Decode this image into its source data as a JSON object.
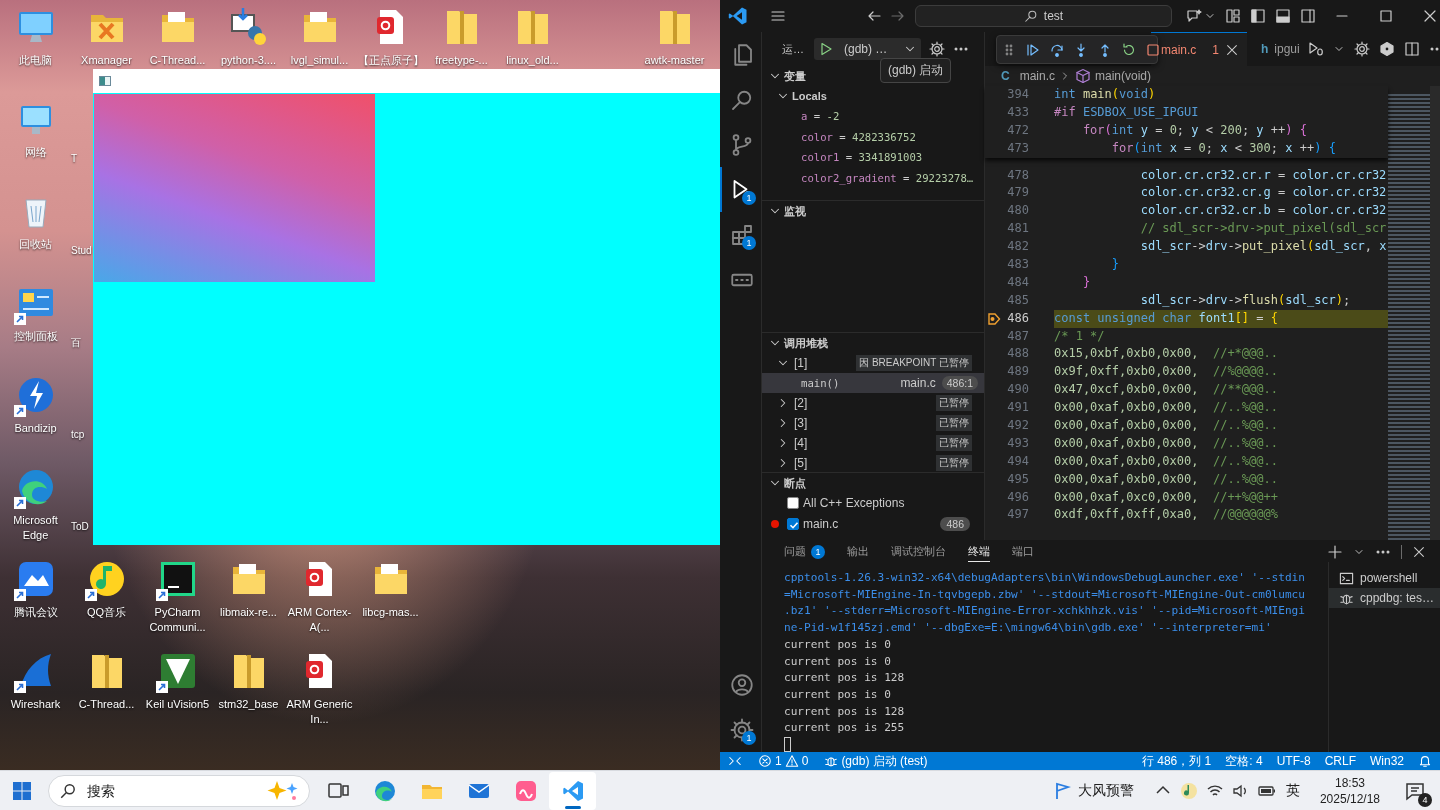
{
  "desktop": {
    "icons": [
      {
        "label": "此电脑",
        "kind": "computer",
        "shortcut": false
      },
      {
        "label": "Xmanager",
        "kind": "xmanager",
        "shortcut": false
      },
      {
        "label": "C-Thread...",
        "kind": "folder",
        "shortcut": false
      },
      {
        "label": "python-3....",
        "kind": "python",
        "shortcut": false
      },
      {
        "label": "lvgl_simul...",
        "kind": "folder",
        "shortcut": false
      },
      {
        "label": "【正点原子】",
        "kind": "pdf",
        "shortcut": false
      },
      {
        "label": "freetype-...",
        "kind": "zip",
        "shortcut": false
      },
      {
        "label": "linux_old...",
        "kind": "zip",
        "shortcut": false
      },
      {
        "label": "awtk-master",
        "kind": "zip",
        "shortcut": false
      },
      {
        "label": "网络",
        "kind": "network",
        "shortcut": false
      },
      {
        "label": "T",
        "kind": "clipped",
        "shortcut": false
      },
      {
        "label": "回收站",
        "kind": "recycle",
        "shortcut": false
      },
      {
        "label": "Stud",
        "kind": "clipped",
        "shortcut": false
      },
      {
        "label": "控制面板",
        "kind": "control",
        "shortcut": true
      },
      {
        "label": "百",
        "kind": "clipped",
        "shortcut": false
      },
      {
        "label": "Bandizip",
        "kind": "bandizip",
        "shortcut": true
      },
      {
        "label": "tcp",
        "kind": "clipped",
        "shortcut": false
      },
      {
        "label": "Microsoft Edge",
        "kind": "edge",
        "shortcut": true
      },
      {
        "label": "ToD",
        "kind": "clipped",
        "shortcut": false
      },
      {
        "label": "腾讯会议",
        "kind": "meeting",
        "shortcut": true
      },
      {
        "label": "QQ音乐",
        "kind": "music",
        "shortcut": true
      },
      {
        "label": "PyCharm Communi...",
        "kind": "pycharm",
        "shortcut": true
      },
      {
        "label": "libmaix-re...",
        "kind": "folder",
        "shortcut": false
      },
      {
        "label": "ARM Cortex-A(...",
        "kind": "pdf",
        "shortcut": false
      },
      {
        "label": "libcg-mas...",
        "kind": "folder",
        "shortcut": false
      },
      {
        "label": "Wireshark",
        "kind": "wireshark",
        "shortcut": true
      },
      {
        "label": "C-Thread...",
        "kind": "zip",
        "shortcut": false
      },
      {
        "label": "Keil uVision5",
        "kind": "keil",
        "shortcut": true
      },
      {
        "label": "stm32_base",
        "kind": "zip",
        "shortcut": false
      },
      {
        "label": "ARM Generic In...",
        "kind": "pdf",
        "shortcut": false
      }
    ]
  },
  "vscode": {
    "title_bar": {
      "search": "test"
    },
    "activity_bar": {
      "top": [
        {
          "kind": "explorer",
          "selected": false
        },
        {
          "kind": "search",
          "selected": false
        },
        {
          "kind": "source_control",
          "selected": false
        },
        {
          "kind": "run_debug",
          "selected": true,
          "badge": "1"
        },
        {
          "kind": "extensions",
          "selected": false,
          "badge": "1"
        },
        {
          "kind": "device",
          "selected": false
        }
      ],
      "bottom": [
        {
          "kind": "account",
          "selected": false
        },
        {
          "kind": "settings",
          "selected": false,
          "badge": "1"
        }
      ]
    },
    "sidebar": {
      "title": "运…",
      "config": "(gdb) …",
      "tooltip": "(gdb) 启动",
      "variables": {
        "title": "变量",
        "expanded": true,
        "scopes": [
          {
            "label": "Locals",
            "expanded": true,
            "children": [
              {
                "name": "a",
                "operator": "=",
                "value": "-2"
              },
              {
                "name": "color",
                "operator": "=",
                "value": "4282336752"
              },
              {
                "name": "color1",
                "operator": "=",
                "value": "3341891003"
              },
              {
                "name": "color2_gradient",
                "operator": "=",
                "value": "29223278…"
              }
            ]
          }
        ]
      },
      "watch": {
        "title": "监视",
        "expanded": true
      },
      "call_stack": {
        "title": "调用堆栈",
        "expanded": true,
        "threads": [
          {
            "label": "[1]",
            "expanded": true,
            "status": "因 BREAKPOINT 已暂停",
            "children": [
              {
                "name": "main()",
                "file": "main.c",
                "position": "486:1",
                "selected": true
              }
            ]
          },
          {
            "label": "[2]",
            "expanded": false,
            "status": "已暂停"
          },
          {
            "label": "[3]",
            "expanded": false,
            "status": "已暂停"
          },
          {
            "label": "[4]",
            "expanded": false,
            "status": "已暂停"
          },
          {
            "label": "[5]",
            "expanded": false,
            "status": "已暂停"
          }
        ]
      },
      "breakpoints": {
        "title": "断点",
        "expanded": true,
        "items": [
          {
            "kind": "exception",
            "label": "All C++ Exceptions",
            "checked": false
          },
          {
            "kind": "line",
            "label": "main.c",
            "checked": true,
            "line": "486"
          }
        ]
      }
    },
    "debug_toolbar": [
      {
        "kind": "continue"
      },
      {
        "kind": "step_over"
      },
      {
        "kind": "step_into"
      },
      {
        "kind": "step_out"
      },
      {
        "kind": "restart"
      },
      {
        "kind": "stop"
      }
    ],
    "editor": {
      "tabs": [
        {
          "label": "main.c",
          "selected": true,
          "problems": "1"
        },
        {
          "label": "ipgui",
          "icon": "h",
          "selected": false
        }
      ],
      "breadcrumb": [
        {
          "kind": "file",
          "icon": "C",
          "label": "main.c"
        },
        {
          "kind": "symbol",
          "label": "main(void)"
        }
      ],
      "sticky_lines": [
        {
          "number": "394",
          "tokens": [
            {
              "kind": "type",
              "text": "int"
            },
            {
              "kind": "function",
              "text": " main"
            },
            {
              "kind": "bracket1",
              "text": "("
            },
            {
              "kind": "type",
              "text": "void"
            },
            {
              "kind": "bracket1",
              "text": ")"
            }
          ]
        },
        {
          "number": "433",
          "tokens": [
            {
              "kind": "control",
              "text": "#if"
            },
            {
              "kind": "type",
              "text": " ESDBOX_USE_IPGUI"
            }
          ]
        },
        {
          "number": "472",
          "tokens": [
            {
              "kind": "control",
              "text": "    for"
            },
            {
              "kind": "bracket2",
              "text": "("
            },
            {
              "kind": "type",
              "text": "int"
            },
            {
              "kind": "variable",
              "text": " y"
            },
            {
              "kind": "plain",
              "text": " ="
            },
            {
              "kind": "number",
              "text": " 0"
            },
            {
              "kind": "plain",
              "text": ";"
            },
            {
              "kind": "variable",
              "text": " y"
            },
            {
              "kind": "plain",
              "text": " <"
            },
            {
              "kind": "number",
              "text": " 200"
            },
            {
              "kind": "plain",
              "text": ";"
            },
            {
              "kind": "variable",
              "text": " y"
            },
            {
              "kind": "plain",
              "text": " ++"
            },
            {
              "kind": "bracket2",
              "text": ")"
            },
            {
              "kind": "bracket2",
              "text": " {"
            }
          ]
        },
        {
          "number": "473",
          "tokens": [
            {
              "kind": "control",
              "text": "        for"
            },
            {
              "kind": "bracket3",
              "text": "("
            },
            {
              "kind": "type",
              "text": "int"
            },
            {
              "kind": "variable",
              "text": " x"
            },
            {
              "kind": "plain",
              "text": " ="
            },
            {
              "kind": "number",
              "text": " 0"
            },
            {
              "kind": "plain",
              "text": ";"
            },
            {
              "kind": "variable",
              "text": " x"
            },
            {
              "kind": "plain",
              "text": " <"
            },
            {
              "kind": "number",
              "text": " 300"
            },
            {
              "kind": "plain",
              "text": ";"
            },
            {
              "kind": "variable",
              "text": " x"
            },
            {
              "kind": "plain",
              "text": " ++"
            },
            {
              "kind": "bracket3",
              "text": ")"
            },
            {
              "kind": "bracket3",
              "text": " {"
            }
          ]
        }
      ],
      "lines": [
        {
          "number": "478",
          "current": false,
          "tokens": [
            {
              "kind": "variable",
              "text": "            color.cr.cr32.cr.r"
            },
            {
              "kind": "plain",
              "text": " ="
            },
            {
              "kind": "variable",
              "text": " color.cr.cr32"
            }
          ]
        },
        {
          "number": "479",
          "current": false,
          "tokens": [
            {
              "kind": "variable",
              "text": "            color.cr.cr32.cr.g"
            },
            {
              "kind": "plain",
              "text": " ="
            },
            {
              "kind": "variable",
              "text": " color.cr.cr32"
            }
          ]
        },
        {
          "number": "480",
          "current": false,
          "tokens": [
            {
              "kind": "variable",
              "text": "            color.cr.cr32.cr.b"
            },
            {
              "kind": "plain",
              "text": " ="
            },
            {
              "kind": "variable",
              "text": " color.cr.cr32"
            }
          ]
        },
        {
          "number": "481",
          "current": false,
          "tokens": [
            {
              "kind": "comment",
              "text": "            // sdl_scr->drv->put_pixel(sdl_scr"
            }
          ]
        },
        {
          "number": "482",
          "current": false,
          "tokens": [
            {
              "kind": "variable",
              "text": "            sdl_scr"
            },
            {
              "kind": "plain",
              "text": "->"
            },
            {
              "kind": "variable",
              "text": "drv"
            },
            {
              "kind": "plain",
              "text": "->"
            },
            {
              "kind": "function",
              "text": "put_pixel"
            },
            {
              "kind": "bracket1",
              "text": "("
            },
            {
              "kind": "variable",
              "text": "sdl_scr"
            },
            {
              "kind": "plain",
              "text": ","
            },
            {
              "kind": "variable",
              "text": " x"
            }
          ]
        },
        {
          "number": "483",
          "current": false,
          "tokens": [
            {
              "kind": "bracket3",
              "text": "        }"
            }
          ]
        },
        {
          "number": "484",
          "current": false,
          "tokens": [
            {
              "kind": "bracket2",
              "text": "    }"
            }
          ]
        },
        {
          "number": "485",
          "current": false,
          "tokens": [
            {
              "kind": "variable",
              "text": "            sdl_scr"
            },
            {
              "kind": "plain",
              "text": "->"
            },
            {
              "kind": "variable",
              "text": "drv"
            },
            {
              "kind": "plain",
              "text": "->"
            },
            {
              "kind": "function",
              "text": "flush"
            },
            {
              "kind": "bracket1",
              "text": "("
            },
            {
              "kind": "variable",
              "text": "sdl_scr"
            },
            {
              "kind": "bracket1",
              "text": ")"
            },
            {
              "kind": "plain",
              "text": ";"
            }
          ]
        },
        {
          "number": "486",
          "current": true,
          "tokens": [
            {
              "kind": "type",
              "text": "const unsigned char"
            },
            {
              "kind": "variable",
              "text": " font1"
            },
            {
              "kind": "bracket1",
              "text": "[]"
            },
            {
              "kind": "plain",
              "text": " ="
            },
            {
              "kind": "bracket1",
              "text": " {"
            }
          ]
        },
        {
          "number": "487",
          "current": false,
          "tokens": [
            {
              "kind": "comment",
              "text": "/* 1 */"
            }
          ]
        },
        {
          "number": "488",
          "current": false,
          "tokens": [
            {
              "kind": "number",
              "text": "0x15,0xbf,0xb0,0x00,"
            },
            {
              "kind": "comment",
              "text": "  //+*@@@.."
            }
          ]
        },
        {
          "number": "489",
          "current": false,
          "tokens": [
            {
              "kind": "number",
              "text": "0x9f,0xff,0xb0,0x00,"
            },
            {
              "kind": "comment",
              "text": "  //%@@@@.."
            }
          ]
        },
        {
          "number": "490",
          "current": false,
          "tokens": [
            {
              "kind": "number",
              "text": "0x47,0xcf,0xb0,0x00,"
            },
            {
              "kind": "comment",
              "text": "  //**@@@.."
            }
          ]
        },
        {
          "number": "491",
          "current": false,
          "tokens": [
            {
              "kind": "number",
              "text": "0x00,0xaf,0xb0,0x00,"
            },
            {
              "kind": "comment",
              "text": "  //..%@@.."
            }
          ]
        },
        {
          "number": "492",
          "current": false,
          "tokens": [
            {
              "kind": "number",
              "text": "0x00,0xaf,0xb0,0x00,"
            },
            {
              "kind": "comment",
              "text": "  //..%@@.."
            }
          ]
        },
        {
          "number": "493",
          "current": false,
          "tokens": [
            {
              "kind": "number",
              "text": "0x00,0xaf,0xb0,0x00,"
            },
            {
              "kind": "comment",
              "text": "  //..%@@.."
            }
          ]
        },
        {
          "number": "494",
          "current": false,
          "tokens": [
            {
              "kind": "number",
              "text": "0x00,0xaf,0xb0,0x00,"
            },
            {
              "kind": "comment",
              "text": "  //..%@@.."
            }
          ]
        },
        {
          "number": "495",
          "current": false,
          "tokens": [
            {
              "kind": "number",
              "text": "0x00,0xaf,0xb0,0x00,"
            },
            {
              "kind": "comment",
              "text": "  //..%@@.."
            }
          ]
        },
        {
          "number": "496",
          "current": false,
          "tokens": [
            {
              "kind": "number",
              "text": "0x00,0xaf,0xc0,0x00,"
            },
            {
              "kind": "comment",
              "text": "  //++%@@++"
            }
          ]
        },
        {
          "number": "497",
          "current": false,
          "tokens": [
            {
              "kind": "number",
              "text": "0xdf,0xff,0xff,0xa0,"
            },
            {
              "kind": "comment",
              "text": "  //@@@@@@%"
            }
          ]
        }
      ]
    },
    "panel": {
      "tabs": [
        {
          "label": "问题",
          "selected": false,
          "badge": "1"
        },
        {
          "label": "输出",
          "selected": false
        },
        {
          "label": "调试控制台",
          "selected": false
        },
        {
          "label": "终端",
          "selected": true
        },
        {
          "label": "端口",
          "selected": false
        }
      ],
      "terminal_lines": [
        {
          "kind": "command",
          "text": "cpptools-1.26.3-win32-x64\\debugAdapters\\bin\\WindowsDebugLauncher.exe' '--stdin"
        },
        {
          "kind": "command",
          "text": "=Microsoft-MIEngine-In-tqvbgepb.zbw' '--stdout=Microsoft-MIEngine-Out-cm0lumcu"
        },
        {
          "kind": "command",
          "text": ".bz1' '--stderr=Microsoft-MIEngine-Error-xchkhhzk.vis' '--pid=Microsoft-MIEngi"
        },
        {
          "kind": "command",
          "text": "ne-Pid-w1f145zj.emd' '--dbgExe=E:\\mingw64\\bin\\gdb.exe' '--interpreter=mi'"
        },
        {
          "kind": "output",
          "text": "current pos is 0"
        },
        {
          "kind": "output",
          "text": "current pos is 0"
        },
        {
          "kind": "output",
          "text": "current pos is 128"
        },
        {
          "kind": "output",
          "text": "current pos is 0"
        },
        {
          "kind": "output",
          "text": "current pos is 128"
        },
        {
          "kind": "output",
          "text": "current pos is 255"
        }
      ],
      "terminals": [
        {
          "kind": "shell",
          "label": "powershell",
          "selected": false
        },
        {
          "kind": "debug",
          "label": "cppdbg: tes…",
          "selected": true
        }
      ]
    },
    "status_bar": {
      "left": [
        {
          "kind": "remote"
        },
        {
          "kind": "problems",
          "errors": "1",
          "warnings": "0"
        },
        {
          "kind": "debug",
          "label": "(gdb) 启动 (test)"
        }
      ],
      "right": [
        {
          "kind": "text",
          "label": "行 486，列 1"
        },
        {
          "kind": "text",
          "label": "空格: 4"
        },
        {
          "kind": "text",
          "label": "UTF-8"
        },
        {
          "kind": "text",
          "label": "CRLF"
        },
        {
          "kind": "text",
          "label": "Win32"
        },
        {
          "kind": "bell"
        }
      ]
    }
  },
  "taskbar": {
    "search": {
      "placeholder": "搜索"
    },
    "apps": [
      {
        "kind": "task_view",
        "active": false
      },
      {
        "kind": "browser",
        "active": false
      },
      {
        "kind": "files",
        "active": false
      },
      {
        "kind": "mail",
        "active": false
      },
      {
        "kind": "pink_app",
        "active": false
      },
      {
        "kind": "code_editor",
        "active": true
      }
    ],
    "weather": "大风预警",
    "tray": [
      {
        "kind": "chevron"
      },
      {
        "kind": "app"
      },
      {
        "kind": "wifi"
      },
      {
        "kind": "speaker"
      },
      {
        "kind": "battery"
      }
    ],
    "input_method": "英",
    "time": "18:53",
    "date": "2025/12/18",
    "notifications": "4"
  }
}
